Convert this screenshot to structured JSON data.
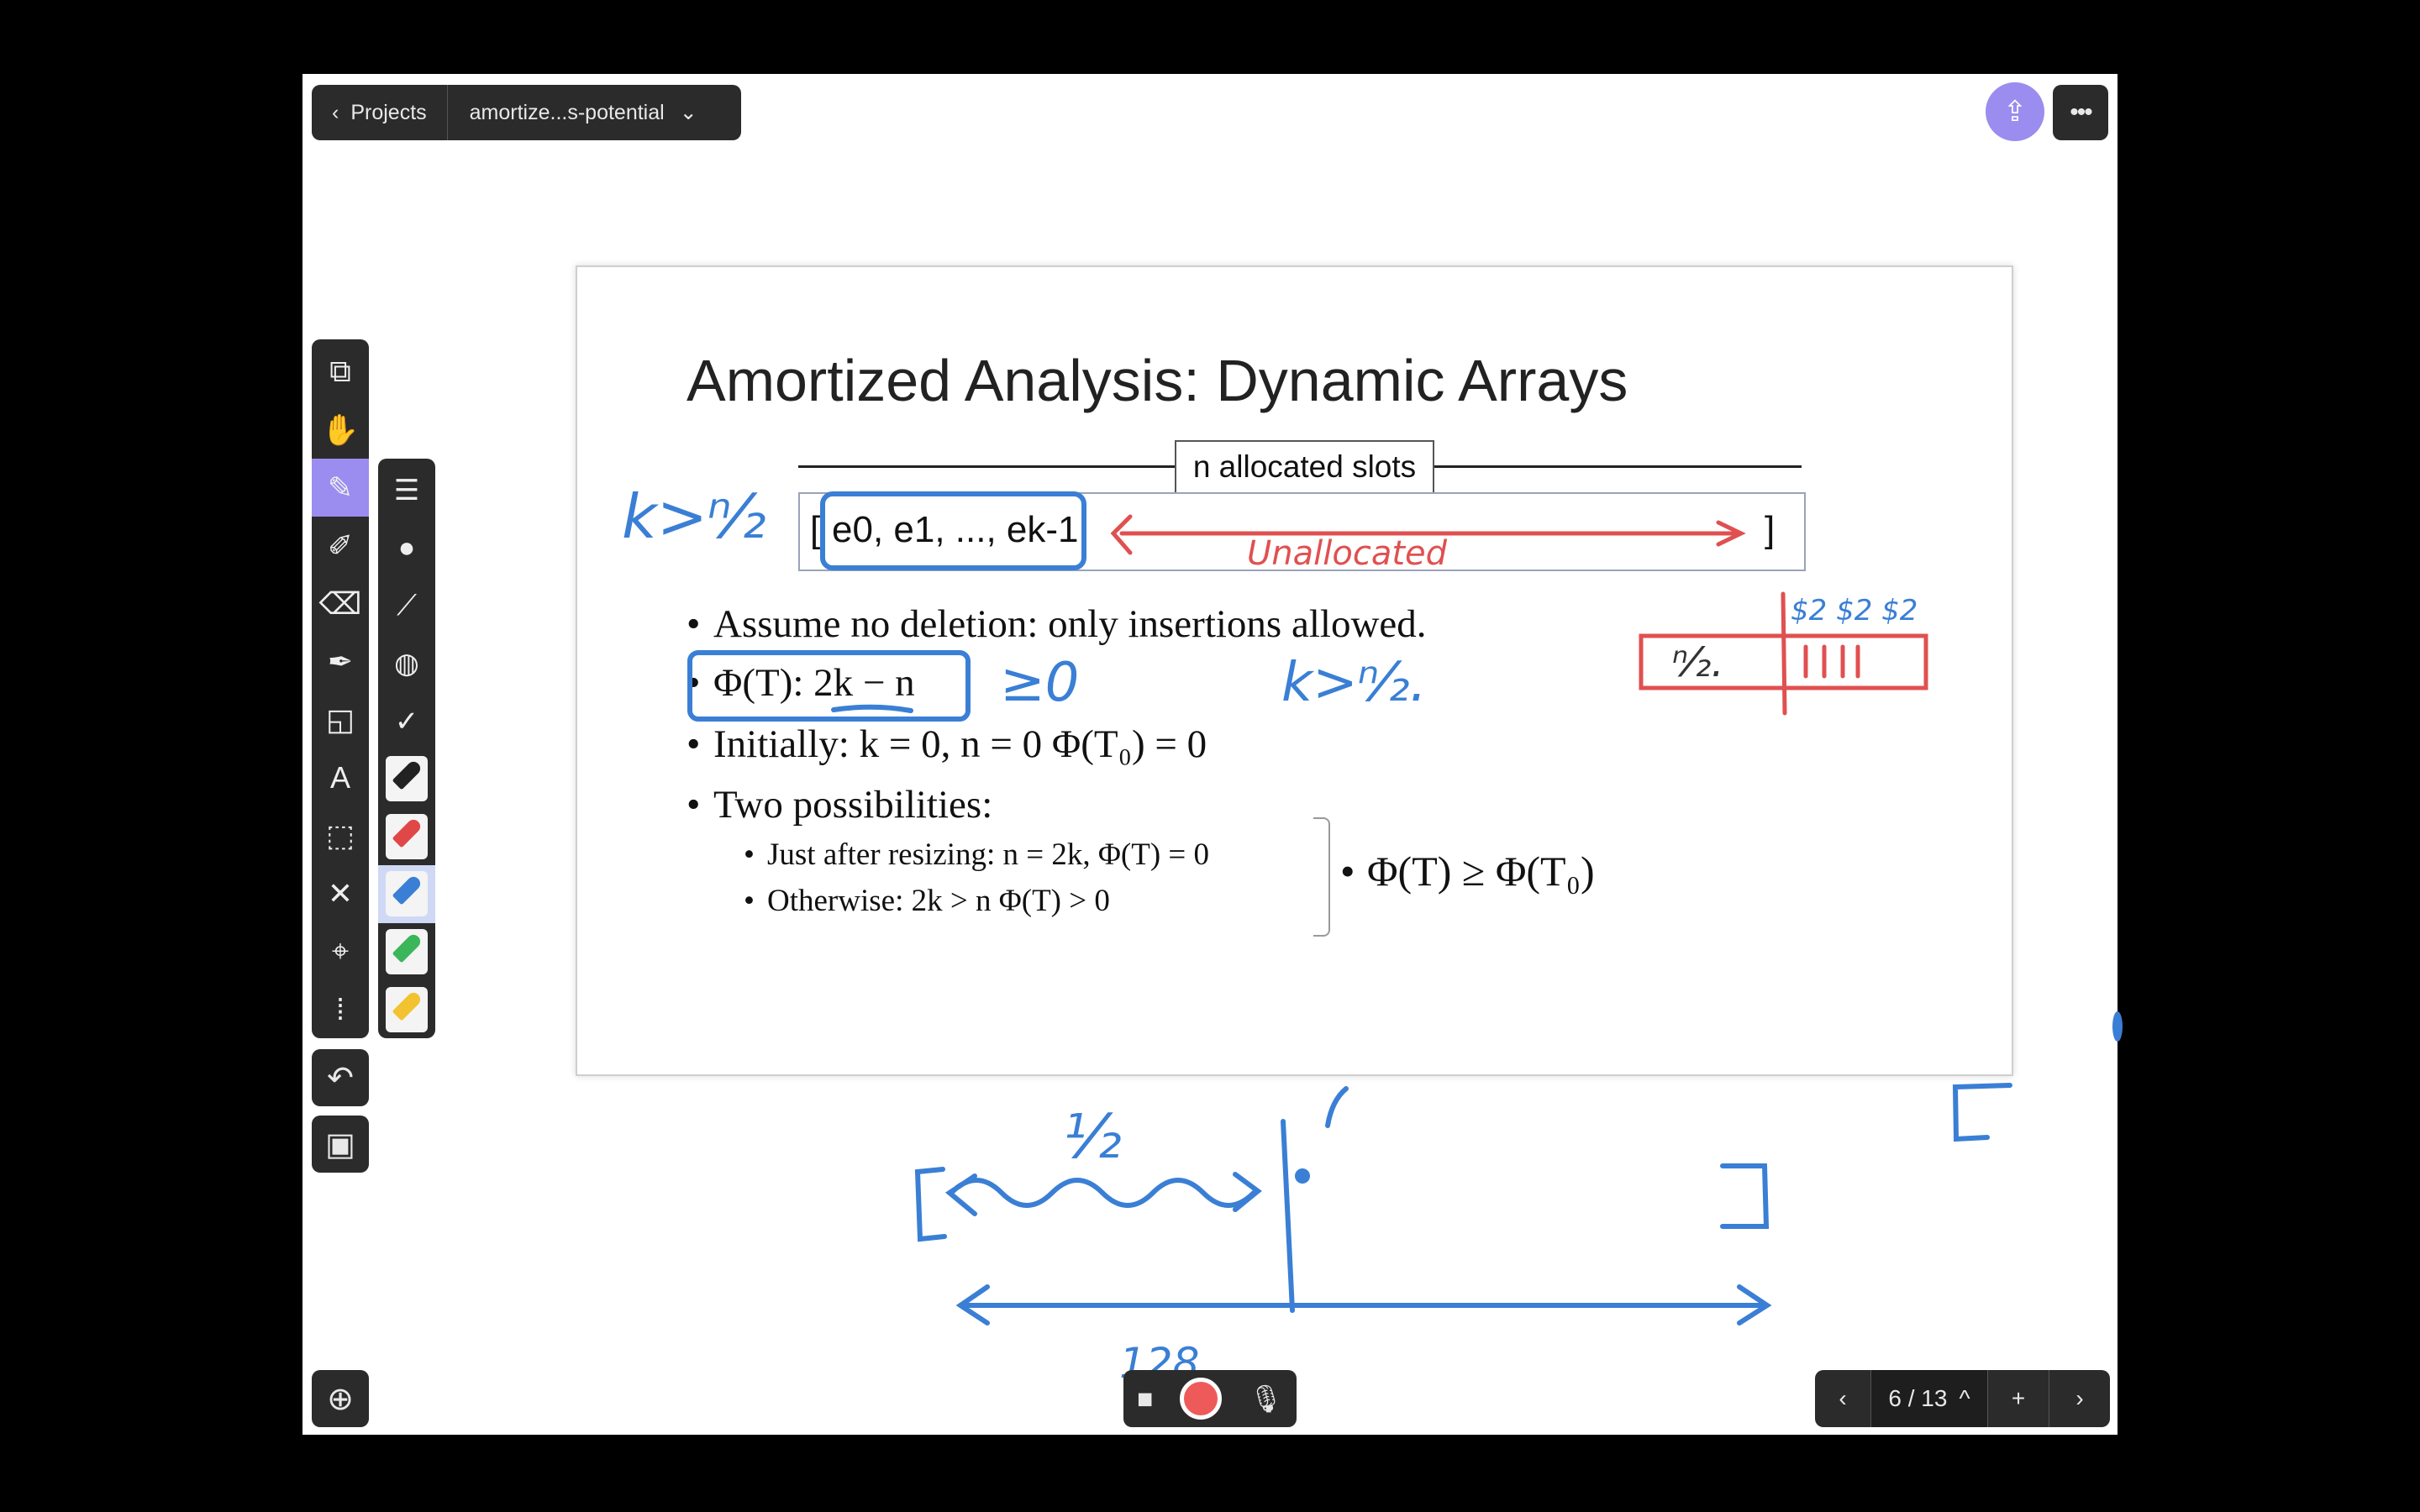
{
  "header": {
    "back_label": "Projects",
    "project_name": "amortize...s-potential",
    "share_icon": "share-icon",
    "more_icon": "more-icon"
  },
  "toolbar": {
    "tools": [
      "pages-add-icon",
      "hand-icon",
      "pen-icon",
      "highlighter-icon",
      "eraser-icon",
      "pen-tool-icon",
      "shapes-icon",
      "text-icon",
      "lasso-select-icon",
      "close-icon",
      "laser-pointer-icon",
      "text-select-icon"
    ],
    "selected": "pen-icon",
    "text_tool_glyph": "A"
  },
  "palette": {
    "selected_pen": "blue",
    "pens": [
      {
        "name": "black",
        "color": "#222222"
      },
      {
        "name": "red",
        "color": "#e04848"
      },
      {
        "name": "blue",
        "color": "#3a7fd5"
      },
      {
        "name": "green",
        "color": "#3cb65a"
      },
      {
        "name": "yellow",
        "color": "#f2c230"
      }
    ]
  },
  "slide": {
    "title": "Amortized Analysis: Dynamic Arrays",
    "slots_label": "n allocated slots",
    "array_open": "[",
    "array_text": "e0, e1, ..., ek-1,",
    "array_close": "]",
    "bullets": [
      "Assume no deletion: only insertions allowed.",
      "Φ(T): 2k − n",
      "Initially: k = 0, n = 0 Φ(T₀) = 0",
      "Two possibilities:"
    ],
    "sub_bullets": [
      "Just after resizing: n = 2k, Φ(T) = 0",
      "Otherwise: 2k > n Φ(T) > 0"
    ],
    "conclusion": "Φ(T) ≥ Φ(T₀)"
  },
  "annotations": {
    "blue": "#3a7fd5",
    "red": "#e05050",
    "k_gt": "k>ⁿ⁄₂",
    "geq0": "≥0",
    "k_gt2": "k>ⁿ⁄₂.",
    "unallocated": "Unallocated",
    "half_n": "ⁿ⁄₂.",
    "dollars": "$2 $2 $2",
    "half": "½",
    "n128": "128"
  },
  "footer": {
    "page_indicator": "6 / 13",
    "zoom_icon": "zoom-in-icon",
    "camera_icon": "camera-icon",
    "record_icon": "record-icon",
    "mic_icon": "mic-icon"
  }
}
